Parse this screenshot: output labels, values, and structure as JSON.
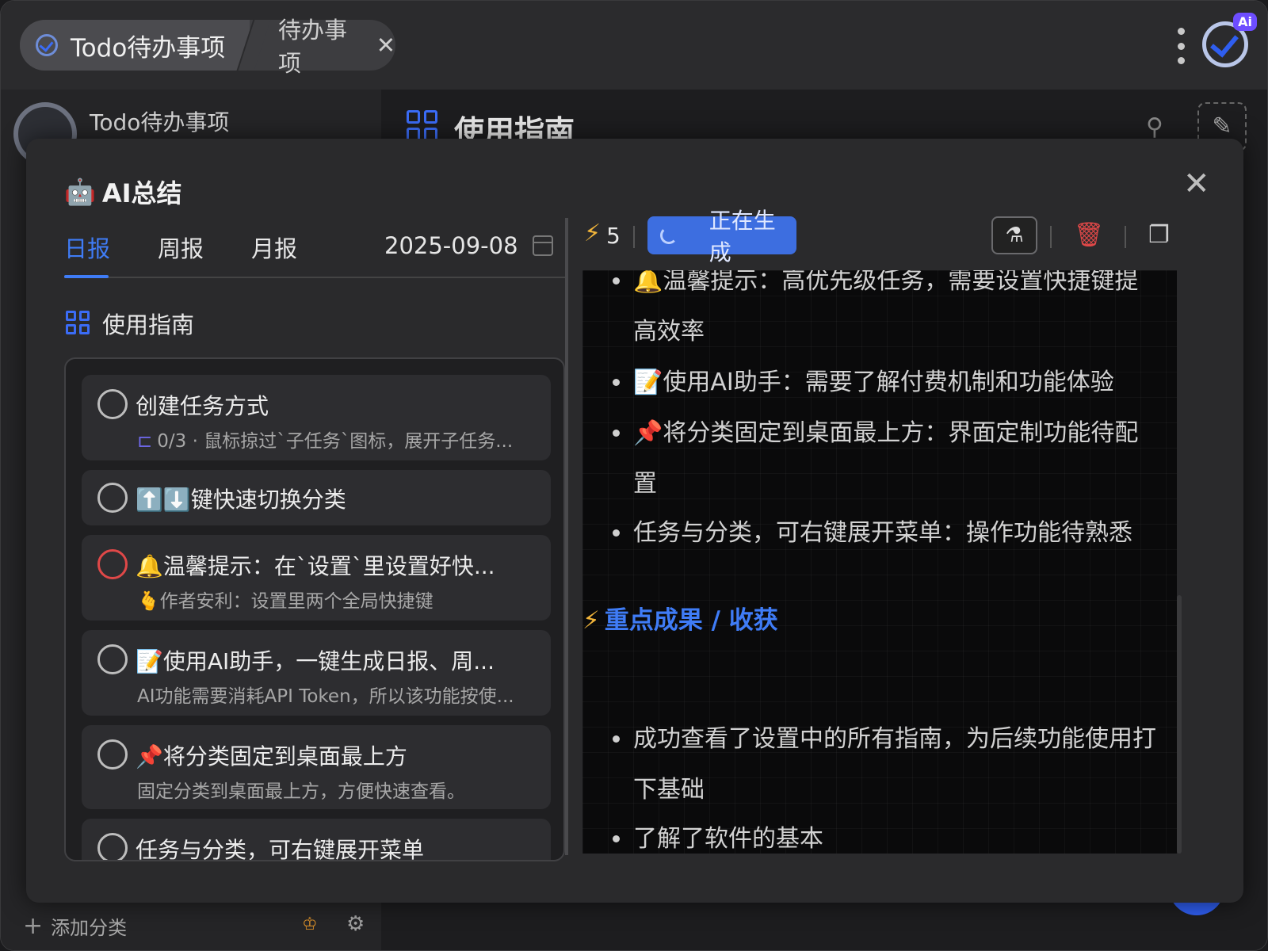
{
  "titlebar": {
    "tab_main": "Todo待办事项",
    "tab_sub": "待办事项",
    "close_glyph": "✕",
    "logo_badge": "Ai"
  },
  "background": {
    "sidebar_title": "Todo待办事项",
    "main_heading": "使用指南",
    "add_category": "添加分类",
    "plus_glyph": "+",
    "pin_glyph": "⚲",
    "edit_glyph": "✎",
    "crown_glyph": "♔",
    "gear_glyph": "⚙"
  },
  "modal": {
    "title_icon": "🤖",
    "title": "AI总结",
    "close_glyph": "✕",
    "tabs": [
      {
        "label": "日报",
        "active": true
      },
      {
        "label": "周报",
        "active": false
      },
      {
        "label": "月报",
        "active": false
      }
    ],
    "date": "2025-09-08",
    "category": "使用指南",
    "tasks": [
      {
        "title": "创建任务方式",
        "sub": "0/3 · 鼠标掠过`子任务`图标，展开子任务...",
        "sub_icon": "⊏",
        "priority_high": false
      },
      {
        "title": "⬆️⬇️键快速切换分类",
        "sub": "",
        "priority_high": false
      },
      {
        "title": "🔔温馨提示：在`设置`里设置好快...",
        "sub": "🫰作者安利：设置里两个全局快捷键",
        "priority_high": true
      },
      {
        "title": "📝使用AI助手，一键生成日报、周...",
        "sub": "AI功能需要消耗API Token，所以该功能按使...",
        "priority_high": false
      },
      {
        "title": "📌将分类固定到桌面最上方",
        "sub": "固定分类到桌面最上方，方便快速查看。",
        "priority_high": false
      },
      {
        "title": "任务与分类，可右键展开菜单",
        "sub": "",
        "priority_high": false
      }
    ],
    "toolbar": {
      "bolt_glyph": "⚡",
      "count": "5",
      "generating": "正在生成",
      "flask_glyph": "⚗",
      "trash_glyph": "🗑",
      "copy_glyph": "❐"
    },
    "summary": {
      "bullets_top": [
        "🔔温馨提示：高优先级任务，需要设置快捷键提高效率",
        "📝使用AI助手：需要了解付费机制和功能体验",
        "📌将分类固定到桌面最上方：界面定制功能待配置",
        "任务与分类，可右键展开菜单：操作功能待熟悉"
      ],
      "section_icon": "⚡",
      "section_title": "重点成果 / 收获",
      "bullets_bottom": [
        "成功查看了设置中的所有指南，为后续功能使用打下基础",
        "了解了软件的基本"
      ]
    }
  },
  "colors": {
    "accent": "#3f7cf6",
    "danger": "#e04848",
    "bolt": "#f2b53a"
  }
}
